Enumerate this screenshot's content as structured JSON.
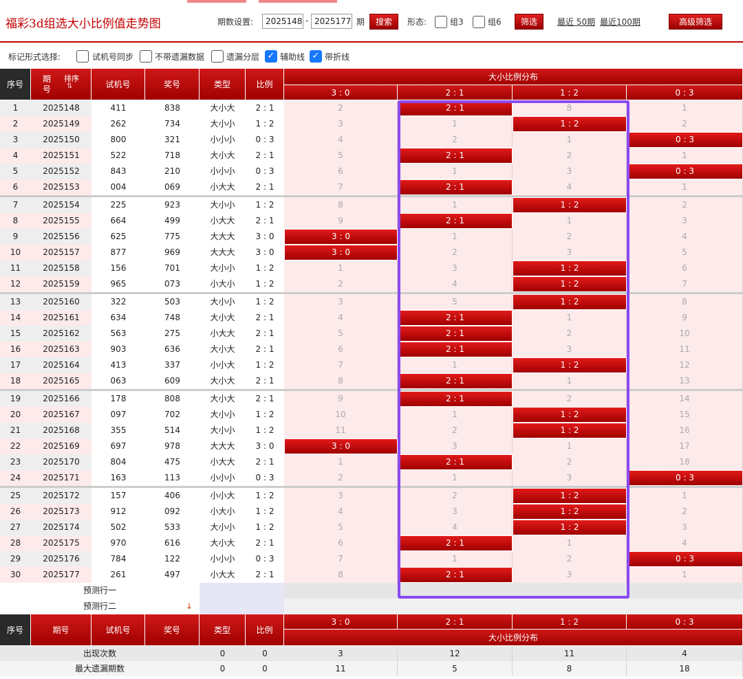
{
  "header": {
    "title": "福彩3d组选大小比例值走势图",
    "period_label": "期数设置:",
    "period_from": "2025148",
    "period_dash": "-",
    "period_to": "2025177",
    "period_unit": "期",
    "search_btn": "搜索",
    "form_label": "形态:",
    "form_opt1": "组3",
    "form_opt2": "组6",
    "filter_btn": "筛选",
    "recent50": "最近 50期",
    "recent100": "最近100期",
    "advanced_btn": "高级筛选"
  },
  "marks": {
    "label": "标记形式选择:",
    "opts": [
      {
        "label": "试机号同步",
        "checked": false
      },
      {
        "label": "不带遗漏数据",
        "checked": false
      },
      {
        "label": "遗漏分层",
        "checked": false
      },
      {
        "label": "辅助线",
        "checked": true
      },
      {
        "label": "带折线",
        "checked": true
      }
    ]
  },
  "table": {
    "h_seq": "序号",
    "h_period": "期号",
    "h_sort": "排序",
    "h_trial": "试机号",
    "h_prize": "奖号",
    "h_type": "类型",
    "h_ratio": "比例",
    "h_dist": "大小比例分布",
    "ratios": [
      "3 : 0",
      "2 : 1",
      "1 : 2",
      "0 : 3"
    ],
    "rows": [
      {
        "seq": "1",
        "period": "2025148",
        "trial": "411",
        "prize": "838",
        "type": "大小大",
        "ratio": "2 : 1",
        "d": [
          "2",
          "2 : 1",
          "8",
          "1"
        ],
        "hit": 1
      },
      {
        "seq": "2",
        "period": "2025149",
        "trial": "262",
        "prize": "734",
        "type": "大小小",
        "ratio": "1 : 2",
        "d": [
          "3",
          "1",
          "1 : 2",
          "2"
        ],
        "hit": 2
      },
      {
        "seq": "3",
        "period": "2025150",
        "trial": "800",
        "prize": "321",
        "type": "小小小",
        "ratio": "0 : 3",
        "d": [
          "4",
          "2",
          "1",
          "0 : 3"
        ],
        "hit": 3
      },
      {
        "seq": "4",
        "period": "2025151",
        "trial": "522",
        "prize": "718",
        "type": "大小大",
        "ratio": "2 : 1",
        "d": [
          "5",
          "2 : 1",
          "2",
          "1"
        ],
        "hit": 1
      },
      {
        "seq": "5",
        "period": "2025152",
        "trial": "843",
        "prize": "210",
        "type": "小小小",
        "ratio": "0 : 3",
        "d": [
          "6",
          "1",
          "3",
          "0 : 3"
        ],
        "hit": 3
      },
      {
        "seq": "6",
        "period": "2025153",
        "trial": "004",
        "prize": "069",
        "type": "小大大",
        "ratio": "2 : 1",
        "d": [
          "7",
          "2 : 1",
          "4",
          "1"
        ],
        "hit": 1
      },
      {
        "seq": "7",
        "period": "2025154",
        "trial": "225",
        "prize": "923",
        "type": "大小小",
        "ratio": "1 : 2",
        "d": [
          "8",
          "1",
          "1 : 2",
          "2"
        ],
        "hit": 2
      },
      {
        "seq": "8",
        "period": "2025155",
        "trial": "664",
        "prize": "499",
        "type": "小大大",
        "ratio": "2 : 1",
        "d": [
          "9",
          "2 : 1",
          "1",
          "3"
        ],
        "hit": 1
      },
      {
        "seq": "9",
        "period": "2025156",
        "trial": "625",
        "prize": "775",
        "type": "大大大",
        "ratio": "3 : 0",
        "d": [
          "3 : 0",
          "1",
          "2",
          "4"
        ],
        "hit": 0
      },
      {
        "seq": "10",
        "period": "2025157",
        "trial": "877",
        "prize": "969",
        "type": "大大大",
        "ratio": "3 : 0",
        "d": [
          "3 : 0",
          "2",
          "3",
          "5"
        ],
        "hit": 0
      },
      {
        "seq": "11",
        "period": "2025158",
        "trial": "156",
        "prize": "701",
        "type": "大小小",
        "ratio": "1 : 2",
        "d": [
          "1",
          "3",
          "1 : 2",
          "6"
        ],
        "hit": 2
      },
      {
        "seq": "12",
        "period": "2025159",
        "trial": "965",
        "prize": "073",
        "type": "小大小",
        "ratio": "1 : 2",
        "d": [
          "2",
          "4",
          "1 : 2",
          "7"
        ],
        "hit": 2
      },
      {
        "seq": "13",
        "period": "2025160",
        "trial": "322",
        "prize": "503",
        "type": "大小小",
        "ratio": "1 : 2",
        "d": [
          "3",
          "5",
          "1 : 2",
          "8"
        ],
        "hit": 2
      },
      {
        "seq": "14",
        "period": "2025161",
        "trial": "634",
        "prize": "748",
        "type": "大小大",
        "ratio": "2 : 1",
        "d": [
          "4",
          "2 : 1",
          "1",
          "9"
        ],
        "hit": 1
      },
      {
        "seq": "15",
        "period": "2025162",
        "trial": "563",
        "prize": "275",
        "type": "小大大",
        "ratio": "2 : 1",
        "d": [
          "5",
          "2 : 1",
          "2",
          "10"
        ],
        "hit": 1
      },
      {
        "seq": "16",
        "period": "2025163",
        "trial": "903",
        "prize": "636",
        "type": "大小大",
        "ratio": "2 : 1",
        "d": [
          "6",
          "2 : 1",
          "3",
          "11"
        ],
        "hit": 1
      },
      {
        "seq": "17",
        "period": "2025164",
        "trial": "413",
        "prize": "337",
        "type": "小小大",
        "ratio": "1 : 2",
        "d": [
          "7",
          "1",
          "1 : 2",
          "12"
        ],
        "hit": 2
      },
      {
        "seq": "18",
        "period": "2025165",
        "trial": "063",
        "prize": "609",
        "type": "大小大",
        "ratio": "2 : 1",
        "d": [
          "8",
          "2 : 1",
          "1",
          "13"
        ],
        "hit": 1
      },
      {
        "seq": "19",
        "period": "2025166",
        "trial": "178",
        "prize": "808",
        "type": "大小大",
        "ratio": "2 : 1",
        "d": [
          "9",
          "2 : 1",
          "2",
          "14"
        ],
        "hit": 1
      },
      {
        "seq": "20",
        "period": "2025167",
        "trial": "097",
        "prize": "702",
        "type": "大小小",
        "ratio": "1 : 2",
        "d": [
          "10",
          "1",
          "1 : 2",
          "15"
        ],
        "hit": 2
      },
      {
        "seq": "21",
        "period": "2025168",
        "trial": "355",
        "prize": "514",
        "type": "大小小",
        "ratio": "1 : 2",
        "d": [
          "11",
          "2",
          "1 : 2",
          "16"
        ],
        "hit": 2
      },
      {
        "seq": "22",
        "period": "2025169",
        "trial": "697",
        "prize": "978",
        "type": "大大大",
        "ratio": "3 : 0",
        "d": [
          "3 : 0",
          "3",
          "1",
          "17"
        ],
        "hit": 0
      },
      {
        "seq": "23",
        "period": "2025170",
        "trial": "804",
        "prize": "475",
        "type": "小大大",
        "ratio": "2 : 1",
        "d": [
          "1",
          "2 : 1",
          "2",
          "18"
        ],
        "hit": 1
      },
      {
        "seq": "24",
        "period": "2025171",
        "trial": "163",
        "prize": "113",
        "type": "小小小",
        "ratio": "0 : 3",
        "d": [
          "2",
          "1",
          "3",
          "0 : 3"
        ],
        "hit": 3
      },
      {
        "seq": "25",
        "period": "2025172",
        "trial": "157",
        "prize": "406",
        "type": "小小大",
        "ratio": "1 : 2",
        "d": [
          "3",
          "2",
          "1 : 2",
          "1"
        ],
        "hit": 2
      },
      {
        "seq": "26",
        "period": "2025173",
        "trial": "912",
        "prize": "092",
        "type": "小大小",
        "ratio": "1 : 2",
        "d": [
          "4",
          "3",
          "1 : 2",
          "2"
        ],
        "hit": 2
      },
      {
        "seq": "27",
        "period": "2025174",
        "trial": "502",
        "prize": "533",
        "type": "大小小",
        "ratio": "1 : 2",
        "d": [
          "5",
          "4",
          "1 : 2",
          "3"
        ],
        "hit": 2
      },
      {
        "seq": "28",
        "period": "2025175",
        "trial": "970",
        "prize": "616",
        "type": "大小大",
        "ratio": "2 : 1",
        "d": [
          "6",
          "2 : 1",
          "1",
          "4"
        ],
        "hit": 1
      },
      {
        "seq": "29",
        "period": "2025176",
        "trial": "784",
        "prize": "122",
        "type": "小小小",
        "ratio": "0 : 3",
        "d": [
          "7",
          "1",
          "2",
          "0 : 3"
        ],
        "hit": 3
      },
      {
        "seq": "30",
        "period": "2025177",
        "trial": "261",
        "prize": "497",
        "type": "小大大",
        "ratio": "2 : 1",
        "d": [
          "8",
          "2 : 1",
          "3",
          "1"
        ],
        "hit": 1
      }
    ],
    "predict1": "预测行一",
    "predict2": "预测行二",
    "stats": [
      {
        "label": "出现次数",
        "type": "0",
        "ratio": "0",
        "d": [
          "3",
          "12",
          "11",
          "4"
        ]
      },
      {
        "label": "最大遗漏期数",
        "type": "0",
        "ratio": "0",
        "d": [
          "11",
          "5",
          "8",
          "18"
        ]
      }
    ]
  },
  "colors": {
    "accent": "#c40000",
    "highlight": "#8a4af3"
  }
}
